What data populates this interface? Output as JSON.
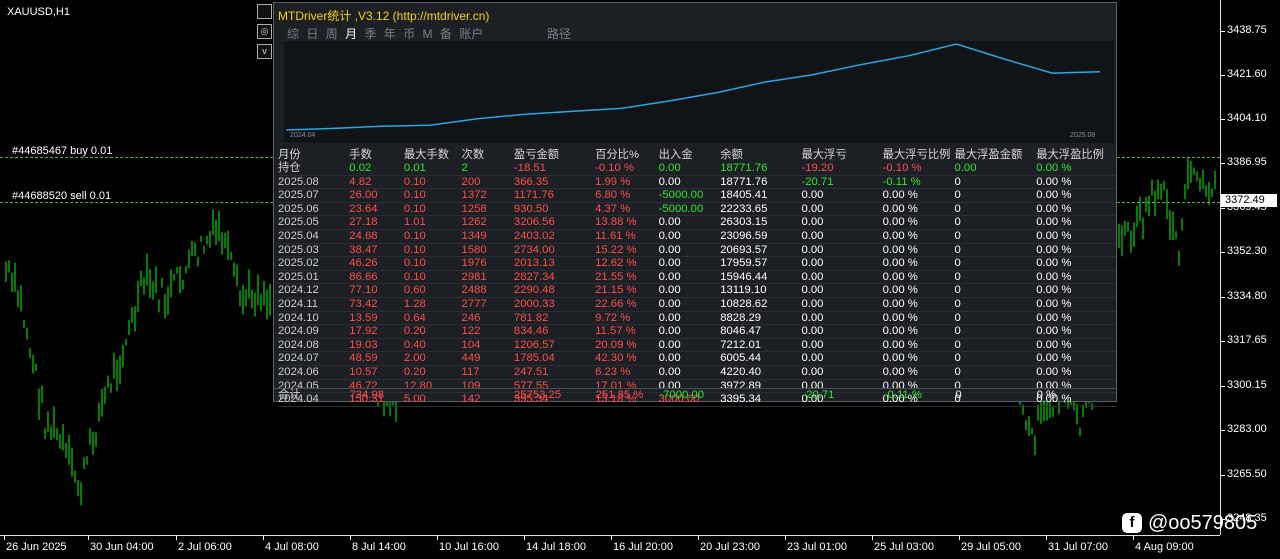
{
  "chart": {
    "symbol": "XAUUSD,H1",
    "current_price": "3372.49",
    "price_labels": [
      "3438.75",
      "3421.60",
      "3404.10",
      "3386.95",
      "3369.45",
      "3352.30",
      "3334.80",
      "3317.65",
      "3300.15",
      "3283.00",
      "3265.50",
      "3248.35"
    ],
    "time_labels": [
      "26 Jun 2025",
      "30 Jun 04:00",
      "2 Jul 06:00",
      "4 Jul 08:00",
      "8 Jul 14:00",
      "10 Jul 16:00",
      "14 Jul 18:00",
      "16 Jul 20:00",
      "20 Jul 23:00",
      "23 Jul 01:00",
      "25 Jul 03:00",
      "29 Jul 05:00",
      "31 Jul 07:00",
      "4 Aug 09:00"
    ],
    "orders": [
      {
        "label": "#44685467 buy 0.01"
      },
      {
        "label": "#44688520 sell 0.01"
      }
    ],
    "colors": {
      "candles": "#00ff00",
      "order_line": "#3cc23c",
      "equity_line": "#2aa6e6"
    }
  },
  "side_buttons": [
    "",
    "◎",
    "v"
  ],
  "panel": {
    "title": "MTDriver统计 ,V3.12 (http://mtdriver.cn)",
    "tabs": [
      "综",
      "日",
      "周",
      "月",
      "季",
      "年",
      "币",
      "M",
      "备",
      "账户"
    ],
    "active_tab": "月",
    "path_tab": "路径",
    "equity_start": "2024.04",
    "equity_end": "2025.08",
    "headers": [
      "月份",
      "手数",
      "最大手数",
      "次数",
      "盈亏金额",
      "百分比%",
      "出入金",
      "余额",
      "最大浮亏",
      "最大浮亏比例",
      "最大浮盈金额",
      "最大浮盈比例"
    ],
    "rows": [
      [
        "持仓",
        "0.02",
        "0.01",
        "2",
        "-18.51",
        "-0.10 %",
        "0.00",
        "18771.76",
        "-19.20",
        "-0.10 %",
        "0.00",
        "0.00 %"
      ],
      [
        "2025.08",
        "4.82",
        "0.10",
        "200",
        "366.35",
        "1.99 %",
        "0.00",
        "18771.76",
        "-20.71",
        "-0.11 %",
        "0",
        "0.00 %"
      ],
      [
        "2025.07",
        "26.00",
        "0.10",
        "1372",
        "1171.76",
        "6.80 %",
        "-5000.00",
        "18405.41",
        "0.00",
        "0.00 %",
        "0",
        "0.00 %"
      ],
      [
        "2025.06",
        "23.64",
        "0.10",
        "1258",
        "930.50",
        "4.37 %",
        "-5000.00",
        "22233.65",
        "0.00",
        "0.00 %",
        "0",
        "0.00 %"
      ],
      [
        "2025.05",
        "27.18",
        "1.01",
        "1262",
        "3206.56",
        "13.88 %",
        "0.00",
        "26303.15",
        "0.00",
        "0.00 %",
        "0",
        "0.00 %"
      ],
      [
        "2025.04",
        "24.68",
        "0.10",
        "1349",
        "2403.02",
        "11.61 %",
        "0.00",
        "23096.59",
        "0.00",
        "0.00 %",
        "0",
        "0.00 %"
      ],
      [
        "2025.03",
        "38.47",
        "0.10",
        "1580",
        "2734.00",
        "15.22 %",
        "0.00",
        "20693.57",
        "0.00",
        "0.00 %",
        "0",
        "0.00 %"
      ],
      [
        "2025.02",
        "46.26",
        "0.10",
        "1976",
        "2013.13",
        "12.62 %",
        "0.00",
        "17959.57",
        "0.00",
        "0.00 %",
        "0",
        "0.00 %"
      ],
      [
        "2025.01",
        "86.66",
        "0.10",
        "2981",
        "2827.34",
        "21.55 %",
        "0.00",
        "15946.44",
        "0.00",
        "0.00 %",
        "0",
        "0.00 %"
      ],
      [
        "2024.12",
        "77.10",
        "0.60",
        "2488",
        "2290.48",
        "21.15 %",
        "0.00",
        "13119.10",
        "0.00",
        "0.00 %",
        "0",
        "0.00 %"
      ],
      [
        "2024.11",
        "73.42",
        "1.28",
        "2777",
        "2000.33",
        "22.66 %",
        "0.00",
        "10828.62",
        "0.00",
        "0.00 %",
        "0",
        "0.00 %"
      ],
      [
        "2024.10",
        "13.59",
        "0.64",
        "246",
        "781.82",
        "9.72 %",
        "0.00",
        "8828.29",
        "0.00",
        "0.00 %",
        "0",
        "0.00 %"
      ],
      [
        "2024.09",
        "17.92",
        "0.20",
        "122",
        "834.46",
        "11.57 %",
        "0.00",
        "8046.47",
        "0.00",
        "0.00 %",
        "0",
        "0.00 %"
      ],
      [
        "2024.08",
        "19.03",
        "0.40",
        "104",
        "1206.57",
        "20.09 %",
        "0.00",
        "7212.01",
        "0.00",
        "0.00 %",
        "0",
        "0.00 %"
      ],
      [
        "2024.07",
        "48.59",
        "2.00",
        "449",
        "1785.04",
        "42.30 %",
        "0.00",
        "6005.44",
        "0.00",
        "0.00 %",
        "0",
        "0.00 %"
      ],
      [
        "2024.06",
        "10.57",
        "0.20",
        "117",
        "247.51",
        "6.23 %",
        "0.00",
        "4220.40",
        "0.00",
        "0.00 %",
        "0",
        "0.00 %"
      ],
      [
        "2024.05",
        "46.72",
        "12.80",
        "109",
        "577.55",
        "17.01 %",
        "0.00",
        "3972.89",
        "0.00",
        "0.00 %",
        "0",
        "0.00 %"
      ],
      [
        "2024.04",
        "150.31",
        "5.00",
        "142",
        "395.34",
        "13.18 %",
        "3000.00",
        "3395.34",
        "0.00",
        "0.00 %",
        "0",
        "0.00 %"
      ]
    ],
    "total": [
      "合计",
      "734.98",
      "",
      "",
      "25753.25",
      "251.85 %",
      "-7000.00",
      "",
      "-20.71",
      "-0.11 %",
      "0",
      "0 %"
    ],
    "equity_curve": [
      2950,
      3395,
      3973,
      4220,
      6005,
      7212,
      8046,
      8828,
      10829,
      13119,
      15946,
      17960,
      20694,
      23097,
      26303,
      22234,
      18405,
      18772
    ]
  },
  "watermark": {
    "icon": "f",
    "text": "@oo579805"
  }
}
